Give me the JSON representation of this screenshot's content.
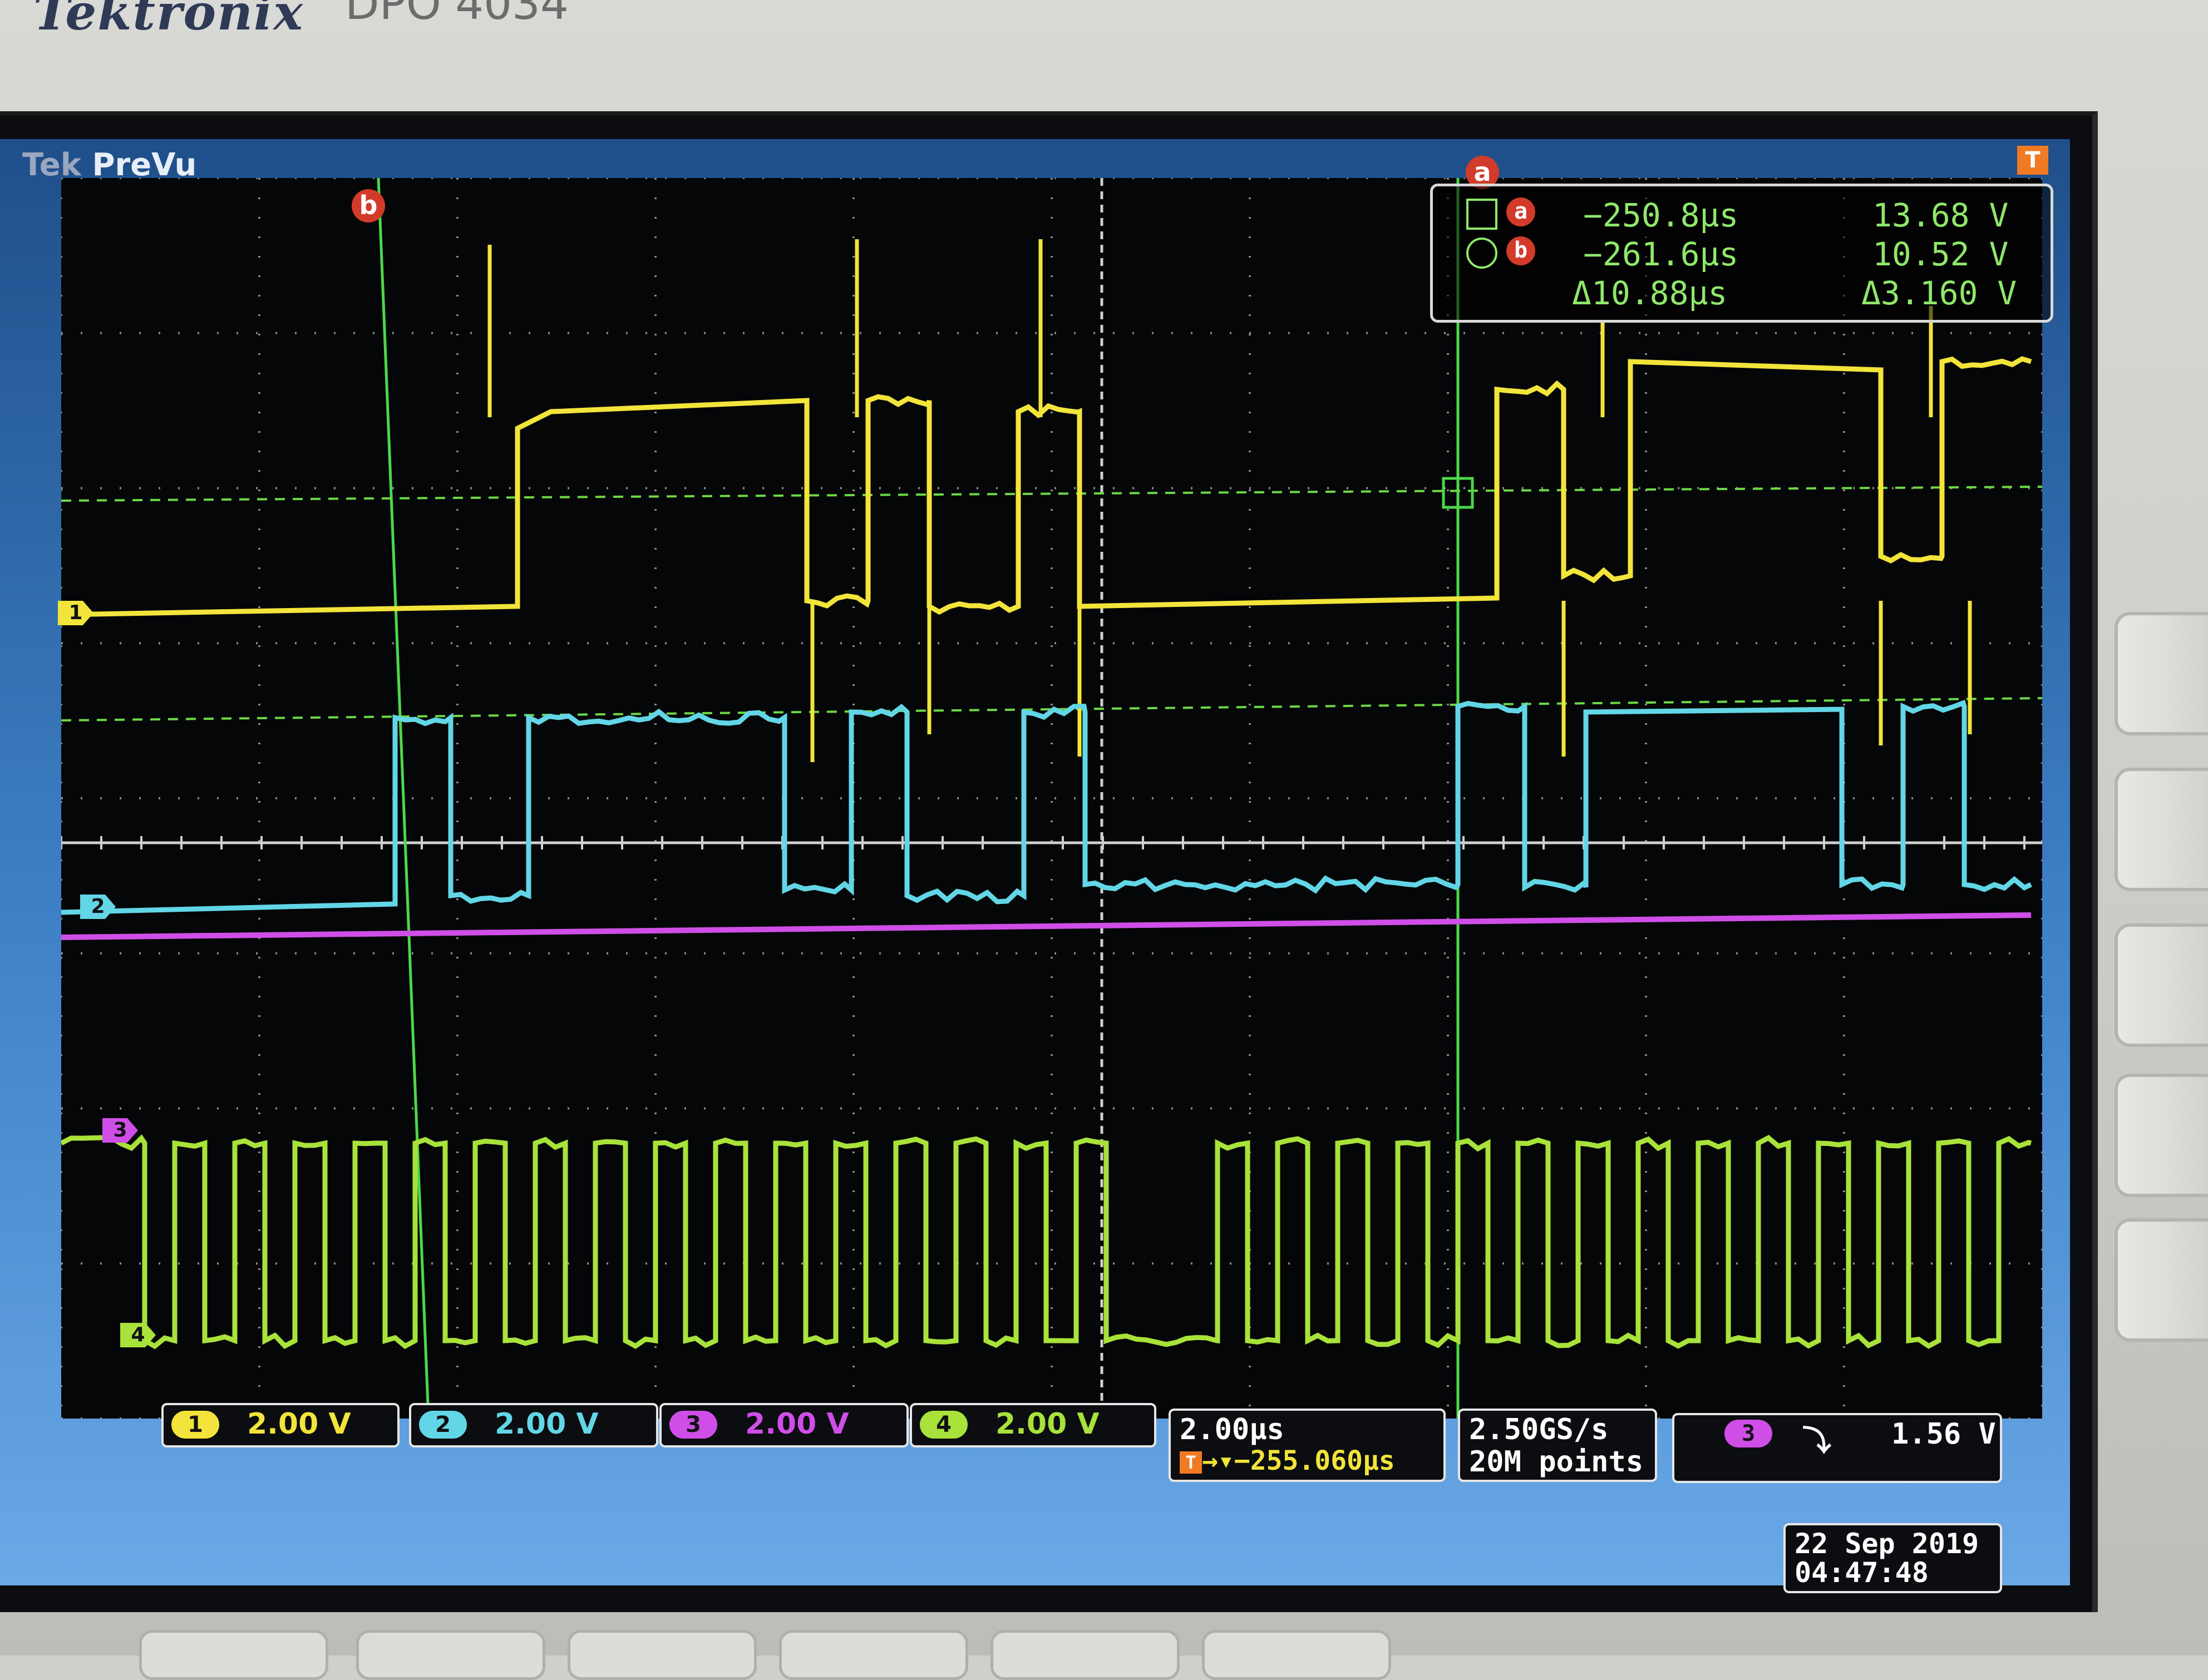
{
  "bezel": {
    "brand": "Tektronix",
    "model": "DPO 4034"
  },
  "screen": {
    "title_prefix": "Tek",
    "title_mode": "PreVu",
    "trigger_marker": "T"
  },
  "cursors": {
    "a": {
      "label": "a",
      "time": "−250.8µs",
      "volt": "13.68 V"
    },
    "b": {
      "label": "b",
      "time": "−261.6µs",
      "volt": "10.52 V"
    },
    "delta_time": "Δ10.88µs",
    "delta_volt": "Δ3.160 V"
  },
  "channels": [
    {
      "id": "1",
      "scale": "2.00 V",
      "color": "#f2e43a"
    },
    {
      "id": "2",
      "scale": "2.00 V",
      "color": "#62d6e6"
    },
    {
      "id": "3",
      "scale": "2.00 V",
      "color": "#d04ee8"
    },
    {
      "id": "4",
      "scale": "2.00 V",
      "color": "#a8e23a"
    }
  ],
  "horizontal": {
    "timebase": "2.00µs",
    "trigger_position": "→▾−255.060µs"
  },
  "acquisition": {
    "sample_rate": "2.50GS/s",
    "record_length": "20M points"
  },
  "trigger": {
    "source": "3",
    "slope_icon": "falling-edge-icon",
    "level": "1.56 V"
  },
  "timestamp": {
    "date": "22 Sep 2019",
    "time": "04:47:48"
  }
}
